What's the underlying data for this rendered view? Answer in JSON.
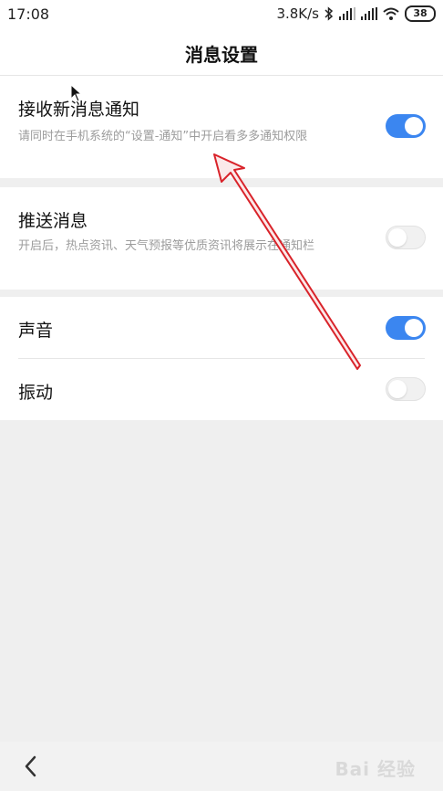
{
  "status_bar": {
    "time": "17:08",
    "speed": "3.8K/s",
    "battery": "38"
  },
  "header": {
    "title": "消息设置"
  },
  "settings": {
    "receive": {
      "title": "接收新消息通知",
      "desc": "请同时在手机系统的“设置-通知”中开启看多多通知权限",
      "enabled": true
    },
    "push": {
      "title": "推送消息",
      "desc": "开启后，热点资讯、天气预报等优质资讯将展示在通知栏",
      "enabled": false
    },
    "sound": {
      "title": "声音",
      "enabled": true
    },
    "vibrate": {
      "title": "振动",
      "enabled": false
    }
  },
  "bottom": {
    "watermark": "Bai 经验"
  },
  "colors": {
    "toggle_on": "#3b86f0",
    "toggle_off": "#f1f1f1",
    "annotation_arrow": "#d9232a"
  }
}
